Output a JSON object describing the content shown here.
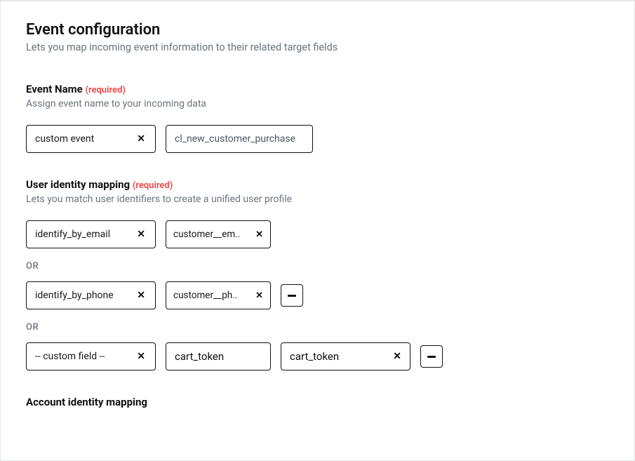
{
  "page": {
    "title": "Event configuration",
    "subtitle": "Lets you map incoming event information to their related target fields"
  },
  "eventName": {
    "heading": "Event Name",
    "required": "(required)",
    "desc": "Assign event name to your incoming data",
    "chip": "custom event",
    "value": "cl_new_customer_purchase"
  },
  "userIdentity": {
    "heading": "User identity mapping",
    "required": "(required)",
    "desc": "Lets you match user identifiers to create a unified user profile",
    "or": "OR",
    "rows": [
      {
        "left": "identify_by_email",
        "right": "customer__em.."
      },
      {
        "left": "identify_by_phone",
        "right": "customer__ph.."
      },
      {
        "left": "-- custom field --",
        "mid": "cart_token",
        "right": "cart_token"
      }
    ]
  },
  "accountIdentity": {
    "heading": "Account identity mapping"
  }
}
